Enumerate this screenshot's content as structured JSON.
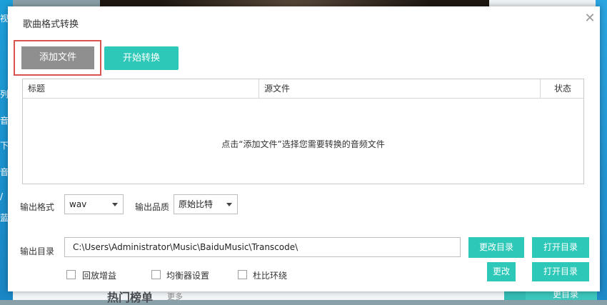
{
  "background": {
    "left_chars": [
      "视",
      "列",
      "音",
      "下",
      "音",
      "/",
      "蓝"
    ],
    "hot_label": "热门榜单",
    "more_label": "更多",
    "ghost_btn_label": "更目录"
  },
  "dialog": {
    "title": "歌曲格式转换",
    "close_icon": "close-icon",
    "add_file_label": "添加文件",
    "start_convert_label": "开始转换",
    "table": {
      "columns": [
        "标题",
        "源文件",
        "状态"
      ],
      "empty_tip": "点击“添加文件”选择您需要转换的音频文件"
    },
    "output_format": {
      "label": "输出格式",
      "value": "wav"
    },
    "output_quality": {
      "label": "输出品质",
      "value": "原始比特"
    },
    "output_dir": {
      "label": "输出目录",
      "value": "C:\\Users\\Administrator\\Music\\BaiduMusic\\Transcode\\",
      "change_label": "更改目录",
      "open_label": "打开目录"
    },
    "options": [
      "回放增益",
      "均衡器设置",
      "杜比环绕"
    ],
    "ghost_buttons": {
      "change_label": "更改",
      "open_label": "打开目录"
    }
  },
  "colors": {
    "accent": "#2dc8b8",
    "add_button": "#8f8f8f",
    "highlight_border": "#d9534f"
  }
}
